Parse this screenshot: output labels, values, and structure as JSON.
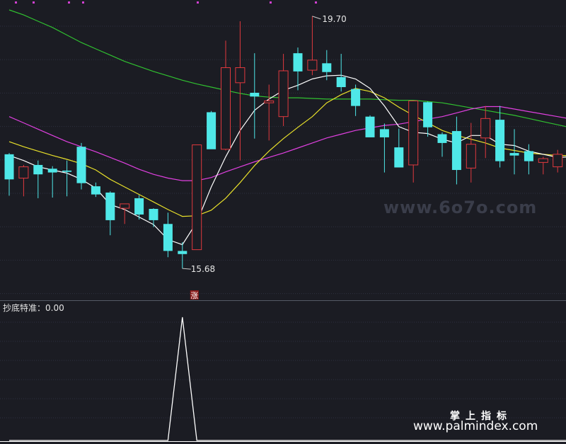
{
  "indicator": {
    "label": "抄底特准：0.00"
  },
  "watermark": {
    "site": "www.6o7o.com",
    "brand_cn": "掌上指标",
    "brand_url": "www.palmindex.com"
  },
  "colors": {
    "bg": "#1b1c23",
    "up": "#e0393e",
    "down": "#4fe8e8",
    "ma5": "#ffffff",
    "ma10": "#e8e02a",
    "ma20": "#e040e0",
    "ma60": "#30c030",
    "grid": "#2e3140"
  },
  "chart_data": [
    {
      "type": "candlestick",
      "annotations": [
        {
          "text": "19.70",
          "kind": "high"
        },
        {
          "text": "15.68",
          "kind": "low"
        },
        {
          "text": "涨",
          "kind": "marker"
        }
      ],
      "ylim": [
        15.4,
        19.8
      ],
      "candles": [
        {
          "o": 17.5,
          "h": 17.52,
          "l": 16.84,
          "c": 17.1
        },
        {
          "o": 17.12,
          "h": 17.33,
          "l": 16.83,
          "c": 17.3
        },
        {
          "o": 17.33,
          "h": 17.4,
          "l": 16.8,
          "c": 17.18
        },
        {
          "o": 17.27,
          "h": 17.31,
          "l": 16.81,
          "c": 17.21
        },
        {
          "o": 17.24,
          "h": 17.4,
          "l": 16.83,
          "c": 17.22
        },
        {
          "o": 17.62,
          "h": 17.68,
          "l": 16.94,
          "c": 17.04
        },
        {
          "o": 16.99,
          "h": 17.05,
          "l": 16.82,
          "c": 16.86
        },
        {
          "o": 16.89,
          "h": 16.91,
          "l": 16.21,
          "c": 16.45
        },
        {
          "o": 16.64,
          "h": 16.71,
          "l": 16.39,
          "c": 16.71
        },
        {
          "o": 16.8,
          "h": 16.85,
          "l": 16.46,
          "c": 16.54
        },
        {
          "o": 16.63,
          "h": 16.64,
          "l": 16.34,
          "c": 16.45
        },
        {
          "o": 16.39,
          "h": 16.57,
          "l": 15.86,
          "c": 15.96
        },
        {
          "o": 15.96,
          "h": 16.1,
          "l": 15.68,
          "c": 15.91
        },
        {
          "o": 15.98,
          "h": 17.62,
          "l": 15.98,
          "c": 17.65
        },
        {
          "o": 18.17,
          "h": 18.19,
          "l": 17.6,
          "c": 17.58
        },
        {
          "o": 17.58,
          "h": 19.31,
          "l": 17.56,
          "c": 18.88
        },
        {
          "o": 18.64,
          "h": 19.62,
          "l": 17.4,
          "c": 18.88
        },
        {
          "o": 18.48,
          "h": 19.11,
          "l": 17.75,
          "c": 18.42
        },
        {
          "o": 18.32,
          "h": 18.61,
          "l": 17.72,
          "c": 18.35
        },
        {
          "o": 18.1,
          "h": 19.1,
          "l": 17.95,
          "c": 18.83
        },
        {
          "o": 19.11,
          "h": 19.2,
          "l": 18.52,
          "c": 18.82
        },
        {
          "o": 18.84,
          "h": 19.7,
          "l": 18.76,
          "c": 19.0
        },
        {
          "o": 18.95,
          "h": 19.16,
          "l": 18.68,
          "c": 18.81
        },
        {
          "o": 18.73,
          "h": 19.1,
          "l": 18.5,
          "c": 18.57
        },
        {
          "o": 18.54,
          "h": 18.61,
          "l": 18.11,
          "c": 18.27
        },
        {
          "o": 18.1,
          "h": 18.12,
          "l": 17.8,
          "c": 17.77
        },
        {
          "o": 17.9,
          "h": 17.99,
          "l": 17.21,
          "c": 17.77
        },
        {
          "o": 17.61,
          "h": 17.91,
          "l": 17.55,
          "c": 17.29
        },
        {
          "o": 17.33,
          "h": 18.31,
          "l": 17.05,
          "c": 18.35
        },
        {
          "o": 18.33,
          "h": 18.34,
          "l": 17.78,
          "c": 17.93
        },
        {
          "o": 17.82,
          "h": 17.85,
          "l": 17.46,
          "c": 17.68
        },
        {
          "o": 17.87,
          "h": 18.1,
          "l": 17.02,
          "c": 17.25
        },
        {
          "o": 17.28,
          "h": 18.0,
          "l": 17.05,
          "c": 17.66
        },
        {
          "o": 17.76,
          "h": 18.27,
          "l": 17.44,
          "c": 18.07
        },
        {
          "o": 18.05,
          "h": 18.27,
          "l": 17.29,
          "c": 17.39
        },
        {
          "o": 17.52,
          "h": 17.9,
          "l": 17.18,
          "c": 17.48
        },
        {
          "o": 17.55,
          "h": 17.66,
          "l": 17.18,
          "c": 17.39
        },
        {
          "o": 17.37,
          "h": 17.46,
          "l": 17.18,
          "c": 17.43
        },
        {
          "o": 17.3,
          "h": 17.57,
          "l": 17.21,
          "c": 17.5
        },
        {
          "o": 17.53,
          "h": 17.66,
          "l": 17.33,
          "c": 17.63
        }
      ],
      "ma5": [
        17.48,
        17.4,
        17.3,
        17.25,
        17.2,
        17.1,
        16.96,
        16.7,
        16.62,
        16.5,
        16.38,
        16.14,
        16.06,
        16.42,
        16.98,
        17.46,
        17.88,
        18.2,
        18.38,
        18.52,
        18.6,
        18.7,
        18.75,
        18.76,
        18.7,
        18.55,
        18.27,
        17.94,
        17.85,
        17.83,
        17.74,
        17.68,
        17.8,
        17.8,
        17.66,
        17.64,
        17.55,
        17.5,
        17.45,
        17.46
      ],
      "ma10": [
        17.7,
        17.62,
        17.55,
        17.48,
        17.42,
        17.35,
        17.25,
        17.1,
        16.98,
        16.86,
        16.74,
        16.62,
        16.51,
        16.52,
        16.61,
        16.8,
        17.05,
        17.32,
        17.55,
        17.75,
        17.93,
        18.1,
        18.32,
        18.45,
        18.55,
        18.5,
        18.4,
        18.25,
        18.12,
        18.0,
        17.88,
        17.8,
        17.74,
        17.68,
        17.6,
        17.56,
        17.52,
        17.5,
        17.48,
        17.48
      ],
      "ma20": [
        18.1,
        18.0,
        17.9,
        17.8,
        17.7,
        17.62,
        17.54,
        17.45,
        17.36,
        17.26,
        17.18,
        17.12,
        17.08,
        17.08,
        17.13,
        17.22,
        17.3,
        17.38,
        17.45,
        17.52,
        17.6,
        17.68,
        17.76,
        17.82,
        17.88,
        17.92,
        17.96,
        17.98,
        18.02,
        18.06,
        18.1,
        18.16,
        18.22,
        18.26,
        18.26,
        18.22,
        18.18,
        18.14,
        18.1,
        18.06
      ],
      "ma60": [
        19.8,
        19.72,
        19.62,
        19.52,
        19.4,
        19.28,
        19.18,
        19.08,
        18.98,
        18.9,
        18.82,
        18.75,
        18.68,
        18.62,
        18.57,
        18.52,
        18.47,
        18.43,
        18.41,
        18.4,
        18.4,
        18.39,
        18.38,
        18.38,
        18.38,
        18.38,
        18.37,
        18.36,
        18.36,
        18.34,
        18.32,
        18.28,
        18.24,
        18.2,
        18.16,
        18.12,
        18.07,
        18.02,
        17.97,
        17.92
      ]
    },
    {
      "type": "line",
      "series": [
        {
          "values": [
            0,
            0,
            0,
            0,
            0,
            0,
            0,
            0,
            0,
            0,
            0,
            0,
            1,
            0,
            0,
            0,
            0,
            0,
            0,
            0,
            0,
            0,
            0,
            0,
            0,
            0,
            0,
            0,
            0,
            0,
            0,
            0,
            0,
            0,
            0,
            0,
            0,
            0,
            0,
            0
          ]
        }
      ],
      "ylim": [
        0,
        1
      ]
    }
  ]
}
